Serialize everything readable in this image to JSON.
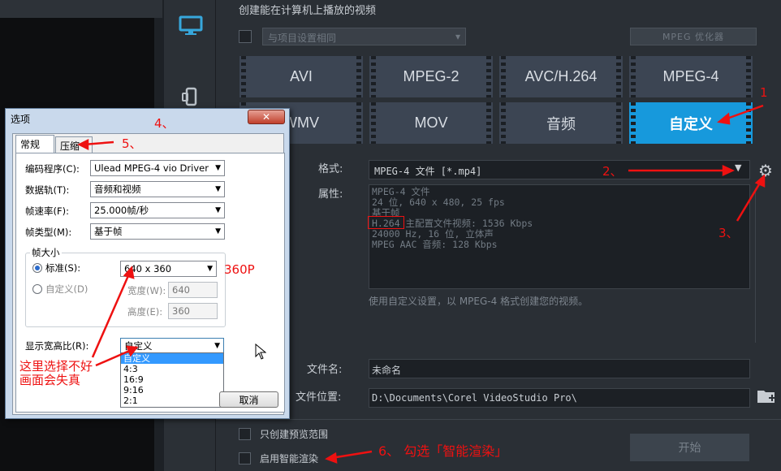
{
  "header": {
    "title": "创建能在计算机上播放的视频"
  },
  "options": {
    "same_as_project": "与项目设置相同",
    "mpeg_optimizer": "MPEG 优化器"
  },
  "formats": [
    "AVI",
    "MPEG-2",
    "AVC/H.264",
    "MPEG-4",
    "WMV",
    "MOV",
    "音频",
    "自定义"
  ],
  "selected_format": "自定义",
  "format": {
    "label": "格式:",
    "value": "MPEG-4 文件 [*.mp4]"
  },
  "properties": {
    "label": "属性:",
    "lines": [
      "MPEG-4 文件",
      "24 位, 640 x 480, 25 fps",
      "基于帧",
      "H.264 主配置文件视频: 1536 Kbps",
      "24000 Hz, 16 位, 立体声",
      "MPEG AAC 音频: 128 Kbps"
    ]
  },
  "note": "使用自定义设置，以 MPEG-4 格式创建您的视频。",
  "file_name": {
    "label": "文件名:",
    "value": "未命名"
  },
  "file_location": {
    "label": "文件位置:",
    "value": "D:\\Documents\\Corel VideoStudio Pro\\"
  },
  "footer": {
    "preview_range": "只创建预览范围",
    "smart_render": "启用智能渲染",
    "start": "开始"
  },
  "dialog": {
    "title": "选项",
    "close": "✕",
    "tabs": [
      "常规",
      "压缩"
    ],
    "encoder": {
      "label": "编码程序(C):",
      "value": "Ulead MPEG-4 vio Driver"
    },
    "tracks": {
      "label": "数据轨(T):",
      "value": "音频和视频"
    },
    "frame_rate": {
      "label": "帧速率(F):",
      "value": "25.000帧/秒"
    },
    "frame_type": {
      "label": "帧类型(M):",
      "value": "基于帧"
    },
    "frame_size": {
      "legend": "帧大小",
      "standard_label": "标准(S):",
      "standard_value": "640 x 360",
      "custom_label": "自定义(D)",
      "width_label": "宽度(W):",
      "width_value": "640",
      "height_label": "高度(E):",
      "height_value": "360"
    },
    "aspect": {
      "label": "显示宽高比(R):",
      "value": "自定义"
    },
    "aspect_options": [
      "自定义",
      "4:3",
      "16:9",
      "9:16",
      "2:1"
    ],
    "cancel": "取消"
  },
  "annotations": {
    "a1": "1",
    "a2": "2、",
    "a3": "3、",
    "a4": "4、",
    "a5": "5、",
    "a6": "6、 勾选「智能渲染」",
    "res": "360P",
    "warn1": "这里选择不好",
    "warn2": "画面会失真"
  },
  "colors": {
    "accent": "#1799dc",
    "annotation": "#ee1111"
  }
}
